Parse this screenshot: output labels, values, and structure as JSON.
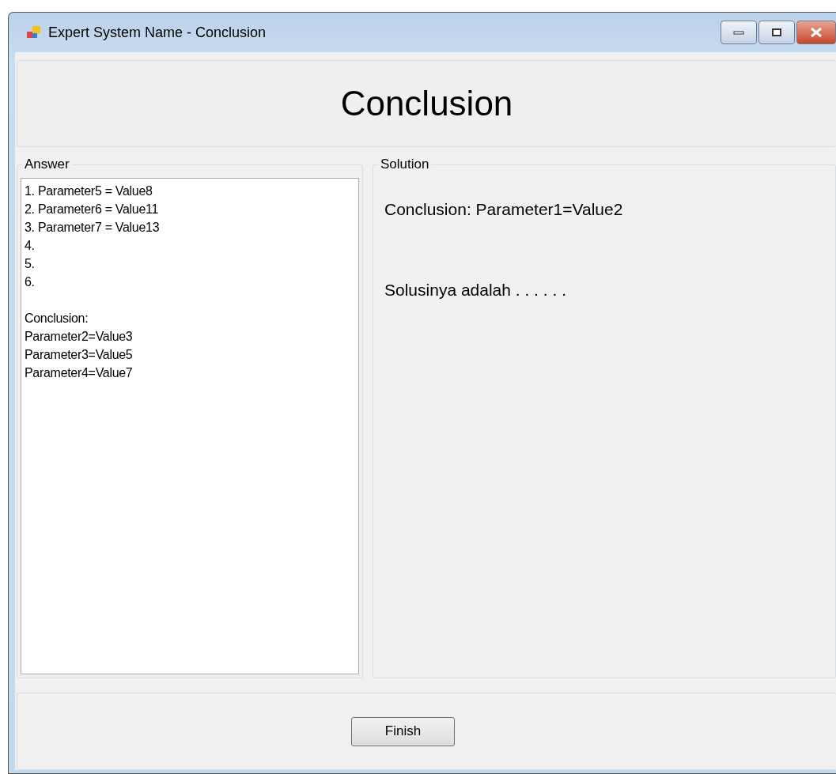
{
  "window": {
    "title": "Expert System Name - Conclusion"
  },
  "heading": "Conclusion",
  "answer_group": {
    "label": "Answer",
    "answers": [
      "1. Parameter5 = Value8",
      "2. Parameter6 = Value11",
      "3. Parameter7 = Value13",
      "4.",
      "5.",
      "6."
    ],
    "conclusion_label": "Conclusion:",
    "conclusions": [
      "Parameter2=Value3",
      "Parameter3=Value5",
      "Parameter4=Value7"
    ]
  },
  "solution_group": {
    "label": "Solution",
    "conclusion": "Conclusion: Parameter1=Value2",
    "solution": "Solusinya adalah . . . . . ."
  },
  "buttons": [
    "Finish"
  ]
}
